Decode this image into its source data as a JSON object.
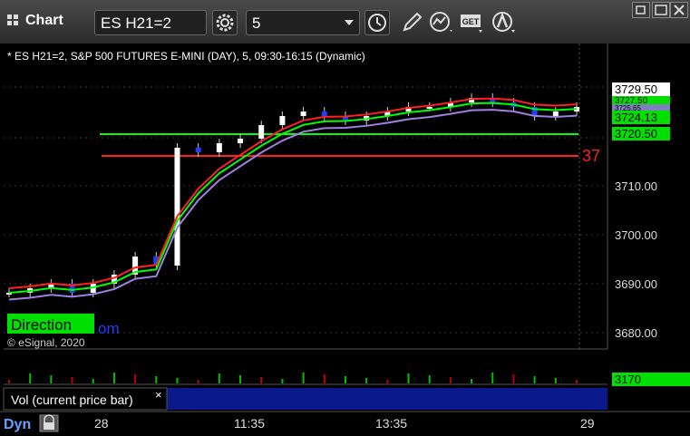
{
  "window": {
    "title": "Chart"
  },
  "toolbar": {
    "symbol": "ES H21=2",
    "interval": "5",
    "icons": [
      "gear-icon",
      "clock-icon",
      "pencil-icon",
      "study-icon",
      "get-icon",
      "cursor-icon"
    ]
  },
  "chart": {
    "header": "* ES H21=2, S&P 500 FUTURES E-MINI (DAY), 5, 09:30-16:15 (Dynamic)",
    "copyright": "© eSignal, 2020",
    "direction_label": "Direction",
    "partial_link": "om",
    "right_line_label": "37",
    "price_labels": [
      "3729.50",
      "3727.50",
      "3725.65",
      "3724.13",
      "3720.50"
    ],
    "price_axis": [
      "3710.00",
      "3700.00",
      "3690.00",
      "3680.00"
    ],
    "volume_label": "3170",
    "volume_study": "Vol (current price bar)",
    "close_glyph": "×",
    "footer_left": "Dyn",
    "time_axis": [
      "28",
      "11:35",
      "13:35",
      "29"
    ],
    "colors": {
      "bg": "#000000",
      "price_tag_white": "#ffffff",
      "price_tag_green": "#00e000",
      "red": "#ff2020",
      "green": "#00ff00",
      "purple": "#a080e0",
      "volume_panel": "#0a1a8a"
    }
  },
  "chart_data": {
    "type": "line",
    "title": "* ES H21=2, S&P 500 FUTURES E-MINI (DAY), 5, 09:30-16:15 (Dynamic)",
    "x": [
      "28",
      "11:35",
      "13:35",
      "29"
    ],
    "ylim": [
      3677,
      3735
    ],
    "y_ticks": [
      3680,
      3690,
      3700,
      3710
    ],
    "series": [
      {
        "values": [
          3688,
          3689,
          3690,
          3688,
          3690,
          3692,
          3696,
          3694,
          3720,
          3719,
          3721,
          3722,
          3725,
          3727,
          3728,
          3727,
          3726,
          3727,
          3728,
          3729,
          3729,
          3730,
          3731,
          3730,
          3729,
          3727,
          3728,
          3729
        ]
      }
    ],
    "levels": [
      3720.5,
      3716
    ],
    "volume": {
      "last": 3170
    }
  }
}
